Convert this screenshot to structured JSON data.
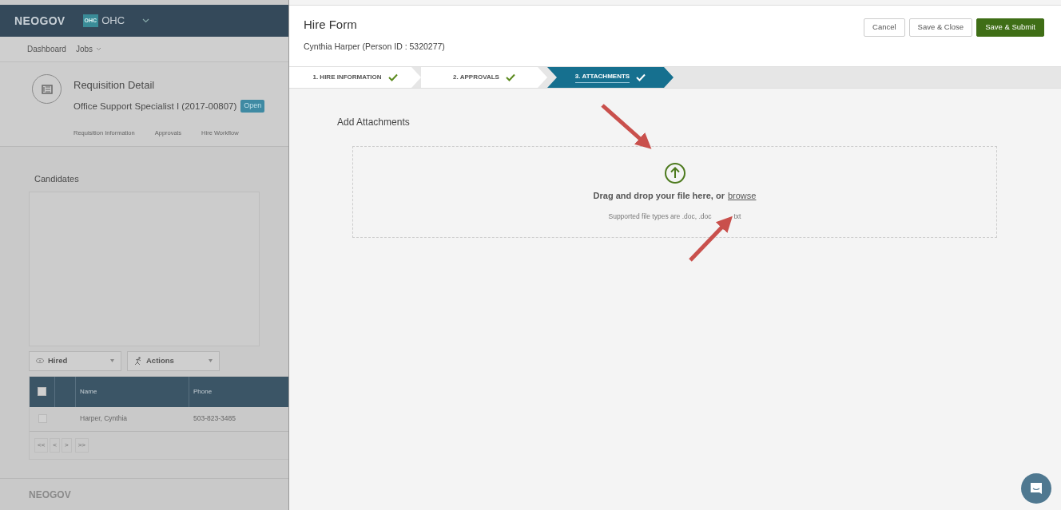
{
  "background_page": {
    "brand": "NEOGOV",
    "org_badge": "OHC",
    "org": "OHC",
    "nav": [
      "Dashboard",
      "Jobs"
    ],
    "requisition": {
      "title": "Requisition Detail",
      "name": "Office Support Specialist I (2017-00807)",
      "status": "Open"
    },
    "tabs": [
      "Requisition Information",
      "Approvals",
      "Hire Workflow"
    ],
    "candidates_title": "Candidates",
    "filter": "Hired",
    "actions": "Actions",
    "table": {
      "header_checked": false,
      "columns": [
        "Name",
        "Phone"
      ],
      "rows": [
        {
          "checked": false,
          "name": "Harper, Cynthia",
          "phone": "503-823-3485"
        }
      ]
    },
    "pager": [
      "<<",
      "<",
      ">",
      ">>"
    ],
    "footer": "NEOGOV"
  },
  "hire_form": {
    "title": "Hire Form",
    "subtitle": "Cynthia Harper (Person ID : 5320277)",
    "buttons": [
      {
        "label": "Cancel",
        "kind": "secondary"
      },
      {
        "label": "Save & Close",
        "kind": "secondary"
      },
      {
        "label": "Save & Submit",
        "kind": "primary"
      }
    ],
    "steps": [
      {
        "label": "1. HIRE INFORMATION",
        "selected": false
      },
      {
        "label": "2. APPROVALS",
        "selected": false
      },
      {
        "label": "3. ATTACHMENTS",
        "selected": true
      }
    ],
    "section_title": "Add Attachments",
    "upload": {
      "text": "Drag and drop your file here, or",
      "link": "browse",
      "hint_start": "Supported file types are .doc, .doc",
      "hint_end": "txt"
    }
  }
}
